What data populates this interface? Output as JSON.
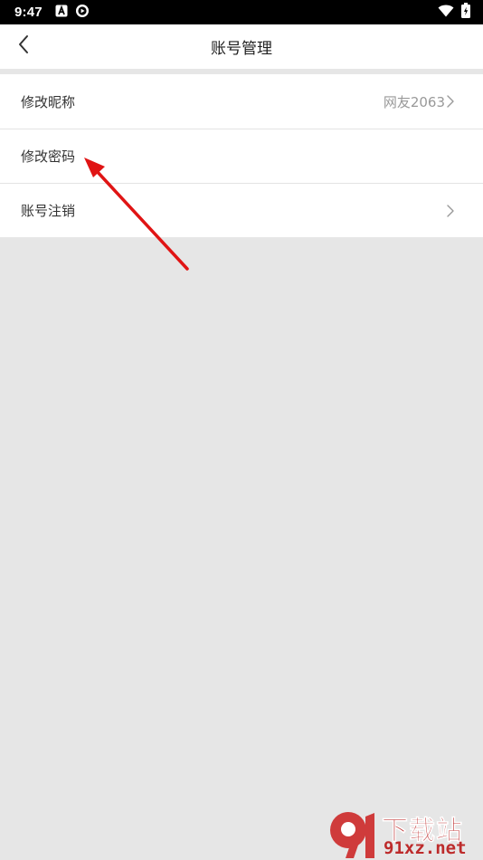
{
  "status_bar": {
    "time": "9:47",
    "left_icons": [
      "a-box-icon",
      "media-play-icon"
    ],
    "right_icons": [
      "wifi-icon",
      "battery-charging-icon"
    ]
  },
  "nav": {
    "title": "账号管理",
    "back_icon": "chevron-left-icon"
  },
  "settings": {
    "items": [
      {
        "label": "修改昵称",
        "value": "网友2063",
        "has_chevron": true
      },
      {
        "label": "修改密码",
        "value": "",
        "has_chevron": false
      },
      {
        "label": "账号注销",
        "value": "",
        "has_chevron": true
      }
    ]
  },
  "annotation": {
    "color": "#e01414",
    "points_to": "修改密码"
  },
  "watermark": {
    "top_text": "下载站",
    "bottom_text": "91xz.net",
    "logo_text": "91",
    "color": "#bd2b2b"
  }
}
